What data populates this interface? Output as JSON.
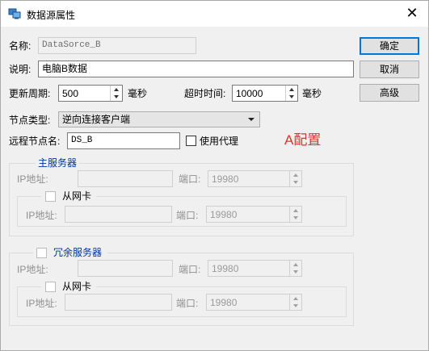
{
  "window": {
    "title": "数据源属性"
  },
  "form": {
    "name_label": "名称:",
    "name_value": "DataSorce_B",
    "desc_label": "说明:",
    "desc_value": "电脑B数据",
    "update_label": "更新周期:",
    "update_value": "500",
    "update_unit": "毫秒",
    "timeout_label": "超时时间:",
    "timeout_value": "10000",
    "timeout_unit": "毫秒",
    "node_type_label": "节点类型:",
    "node_type_value": "逆向连接客户端",
    "remote_node_label": "远程节点名:",
    "remote_node_value": "DS_B",
    "use_proxy_label": "使用代理"
  },
  "buttons": {
    "ok": "确定",
    "cancel": "取消",
    "advanced": "高级"
  },
  "annotation": "A配置",
  "main_server": {
    "title": "主服务器",
    "ip_label": "IP地址:",
    "port_label": "端口:",
    "port_value": "19980",
    "slave_nic": {
      "title": "从网卡",
      "ip_label": "IP地址:",
      "port_label": "端口:",
      "port_value": "19980"
    }
  },
  "redundant_server": {
    "title": "冗余服务器",
    "ip_label": "IP地址:",
    "port_label": "端口:",
    "port_value": "19980",
    "slave_nic": {
      "title": "从网卡",
      "ip_label": "IP地址:",
      "port_label": "端口:",
      "port_value": "19980"
    }
  },
  "colors": {
    "annotation": "#e0312b",
    "group_title": "#0033a0",
    "default_button_border": "#0078d7"
  }
}
